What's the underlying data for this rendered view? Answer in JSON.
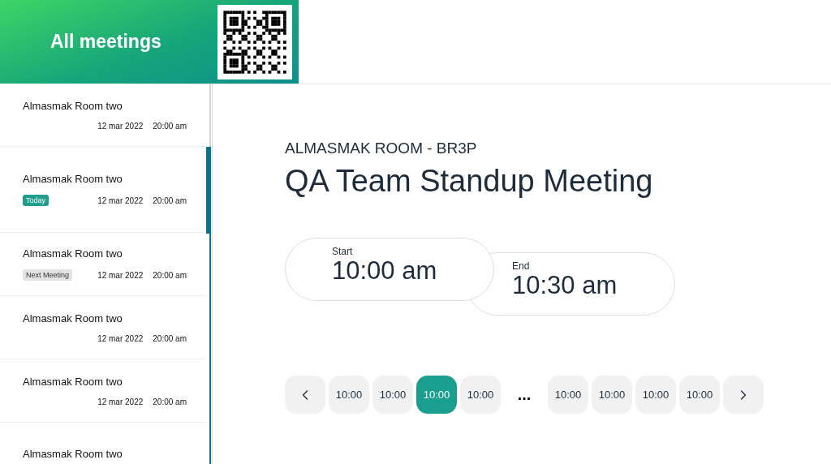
{
  "header": {
    "title": "All meetings"
  },
  "meetings": [
    {
      "room": "Almasmak Room two",
      "date": "12 mar 2022",
      "time": "20:00 am",
      "kind": "plain"
    },
    {
      "room": "Almasmak Room two",
      "date": "12 mar 2022",
      "time": "20:00 am",
      "kind": "badge",
      "badge": "Today",
      "color": "#1f9e8e"
    },
    {
      "room": "Almasmak Room two",
      "date": "12 mar 2022",
      "time": "20:00 am",
      "kind": "badge",
      "badge": "Next Meeting",
      "color": "#e3e3e3"
    },
    {
      "room": "Almasmak Room two",
      "date": "12 mar 2022",
      "time": "20:00 am",
      "kind": "plain"
    },
    {
      "room": "Almasmak Room two",
      "date": "12 mar 2022",
      "time": "20:00 am",
      "kind": "plain"
    },
    {
      "room": "Almasmak Room two",
      "kind": "plain"
    }
  ],
  "room_label": "ALMASMAK ROOM - BR3P",
  "meeting_title": "QA Team Standup Meeting",
  "start": {
    "label": "Start",
    "time": "10:00 am"
  },
  "end": {
    "label": "End",
    "time": "10:30 am"
  },
  "slots": [
    {
      "kind": "prev"
    },
    {
      "kind": "time",
      "label": "10:00",
      "selected": false
    },
    {
      "kind": "time",
      "label": "10:00",
      "selected": false
    },
    {
      "kind": "time",
      "label": "10:00",
      "selected": true
    },
    {
      "kind": "time",
      "label": "10:00",
      "selected": false
    },
    {
      "kind": "gap",
      "label": "..."
    },
    {
      "kind": "time",
      "label": "10:00",
      "selected": false
    },
    {
      "kind": "time",
      "label": "10:00",
      "selected": false
    },
    {
      "kind": "time",
      "label": "10:00",
      "selected": false
    },
    {
      "kind": "time",
      "label": "10:00",
      "selected": false
    },
    {
      "kind": "next"
    }
  ]
}
